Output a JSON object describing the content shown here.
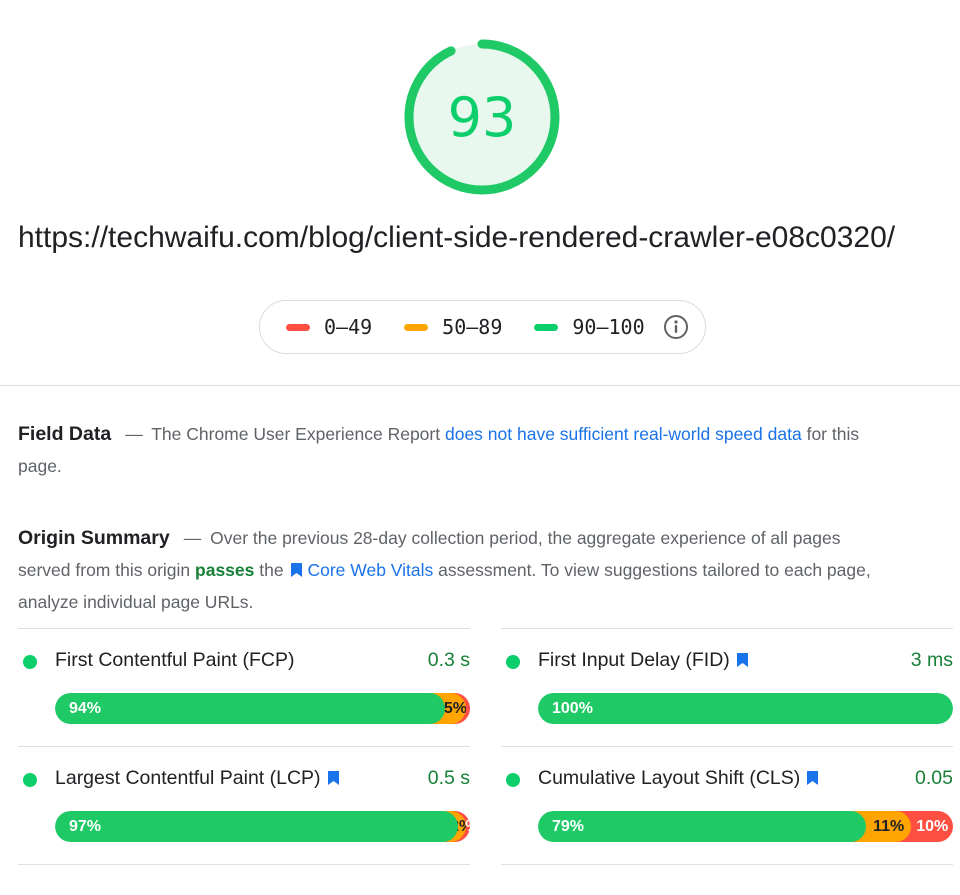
{
  "score": {
    "value": "93",
    "fraction": 0.93,
    "color": "#0cce6b"
  },
  "url": "https://techwaifu.com/blog/client-side-rendered-crawler-e08c0320/",
  "legend": {
    "items": [
      {
        "label": "0–49",
        "color": "#ff4e42"
      },
      {
        "label": "50–89",
        "color": "#ffa400"
      },
      {
        "label": "90–100",
        "color": "#0cce6b"
      }
    ],
    "info_icon": "info-icon"
  },
  "field_data": {
    "title": "Field Data",
    "dash": "—",
    "text_before": "The Chrome User Experience Report",
    "link": "does not have sufficient real-world speed data",
    "text_after": "for this page."
  },
  "origin_summary": {
    "title": "Origin Summary",
    "dash": "—",
    "text_1": "Over the previous 28-day collection period, the aggregate experience of all pages served from this origin",
    "pass_word": "passes",
    "text_2": "the",
    "link": "Core Web Vitals",
    "text_3": "assessment. To view suggestions tailored to each page, analyze individual page URLs."
  },
  "metrics": [
    {
      "name": "First Contentful Paint (FCP)",
      "value": "0.3 s",
      "core": false,
      "dist": [
        94,
        5,
        1
      ],
      "labels": [
        "94%",
        "5%",
        ""
      ]
    },
    {
      "name": "First Input Delay (FID)",
      "value": "3 ms",
      "core": true,
      "dist": [
        100,
        0,
        0
      ],
      "labels": [
        "100%",
        "",
        ""
      ]
    },
    {
      "name": "Largest Contentful Paint (LCP)",
      "value": "0.5 s",
      "core": true,
      "dist": [
        97,
        2,
        1
      ],
      "labels": [
        "97%",
        "2%",
        "1%"
      ]
    },
    {
      "name": "Cumulative Layout Shift (CLS)",
      "value": "0.05",
      "core": true,
      "dist": [
        79,
        11,
        10
      ],
      "labels": [
        "79%",
        "11%",
        "10%"
      ]
    }
  ]
}
